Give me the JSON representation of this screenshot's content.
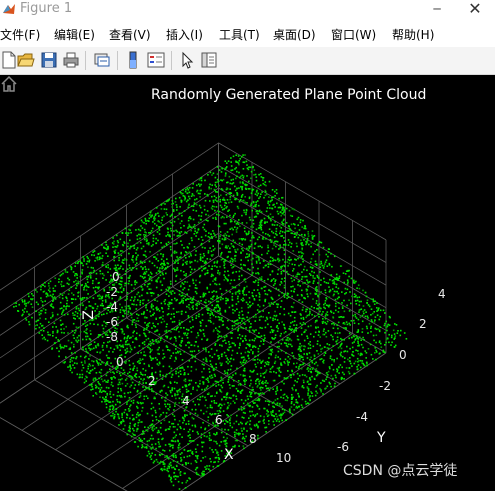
{
  "window": {
    "title": "Figure 1"
  },
  "menu": {
    "items": [
      {
        "label": "文件(F)"
      },
      {
        "label": "编辑(E)"
      },
      {
        "label": "查看(V)"
      },
      {
        "label": "插入(I)"
      },
      {
        "label": "工具(T)"
      },
      {
        "label": "桌面(D)"
      },
      {
        "label": "窗口(W)"
      },
      {
        "label": "帮助(H)"
      }
    ]
  },
  "toolbar": {
    "icons": [
      "new-figure-icon",
      "open-icon",
      "save-icon",
      "print-icon",
      "link-icon",
      "colorbar-icon",
      "legend-icon",
      "pointer-icon",
      "property-inspector-icon"
    ]
  },
  "colors": {
    "points": "#00e000",
    "background": "#000000",
    "grid": "#5a5a5a"
  },
  "chart_data": {
    "type": "scatter",
    "projection": "3d",
    "title": "Randomly Generated Plane Point Cloud",
    "xlabel": "X",
    "ylabel": "Y",
    "zlabel": "Z",
    "x_ticks": [
      "0",
      "2",
      "4",
      "6",
      "8",
      "10"
    ],
    "y_ticks": [
      "-6",
      "-4",
      "-2",
      "0",
      "2",
      "4"
    ],
    "z_ticks": [
      "0",
      "-2",
      "-4",
      "-6",
      "-8"
    ],
    "xlim": [
      0,
      10
    ],
    "ylim": [
      -6,
      4
    ],
    "zlim": [
      -8,
      0
    ],
    "grid": true,
    "series": [
      {
        "marker": "point",
        "color": "#00e000",
        "plane_corners": [
          {
            "x": 0,
            "y": -5,
            "z": 0
          },
          {
            "x": 0,
            "y": 5,
            "z": 0
          },
          {
            "x": 10,
            "y": 5,
            "z": -8
          },
          {
            "x": 10,
            "y": -5,
            "z": -8
          }
        ]
      }
    ]
  },
  "watermark": "CSDN @点云学徒"
}
